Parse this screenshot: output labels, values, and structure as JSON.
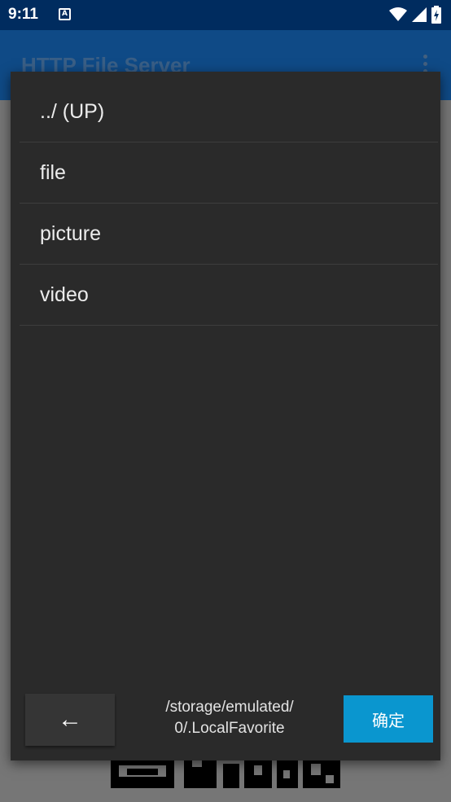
{
  "status_bar": {
    "time": "9:11",
    "notification_icon": "A",
    "icons": [
      "wifi-icon",
      "signal-icon",
      "battery-charging-icon"
    ]
  },
  "app_bar": {
    "title": "HTTP File Server",
    "menu_icon": "more-vert-icon"
  },
  "dialog": {
    "items": [
      {
        "label": "../ (UP)"
      },
      {
        "label": "file"
      },
      {
        "label": "picture"
      },
      {
        "label": "video"
      }
    ],
    "back_label": "←",
    "path_line1": "/storage/emulated/",
    "path_line2": "0/.LocalFavorite",
    "ok_label": "确定"
  },
  "colors": {
    "status_bar": "#002c5f",
    "app_bar": "#0f4a86",
    "dialog_bg": "#2a2a2a",
    "accent": "#0a96cf"
  }
}
